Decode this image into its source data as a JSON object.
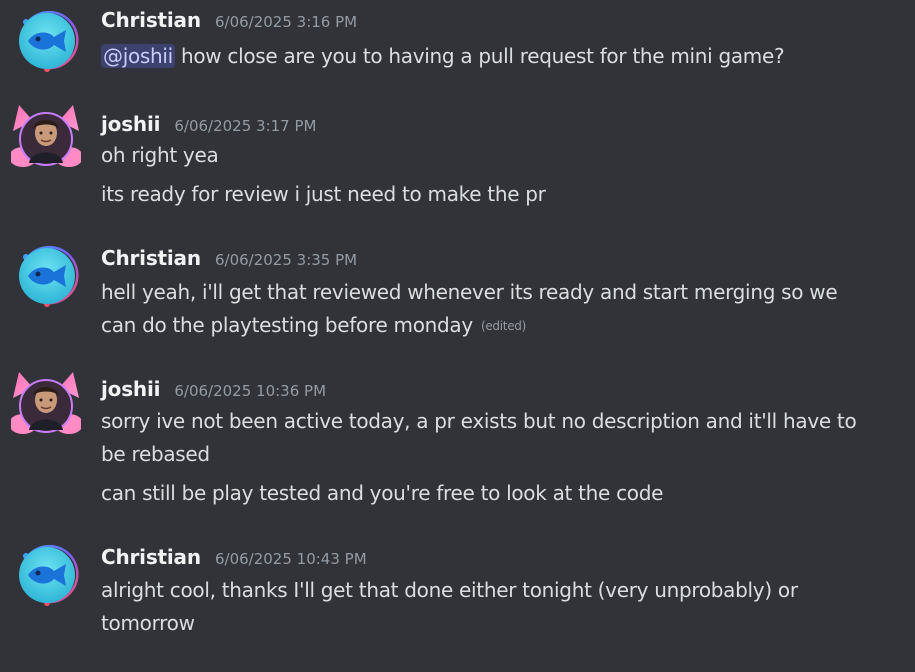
{
  "messages": [
    {
      "author": "Christian",
      "timestamp": "6/06/2025 3:16 PM",
      "avatar": "fish-avatar-icon",
      "lines": [
        {
          "mention": "@joshii",
          "text": " how close are you to having a pull request for the mini game?"
        }
      ]
    },
    {
      "author": "joshii",
      "timestamp": "6/06/2025 3:17 PM",
      "avatar": "photo-avatar",
      "lines": [
        {
          "text": "oh right yea"
        },
        {
          "text": "its ready for review i just need to make the pr"
        }
      ]
    },
    {
      "author": "Christian",
      "timestamp": "6/06/2025 3:35 PM",
      "avatar": "fish-avatar-icon",
      "lines": [
        {
          "text": "hell yeah, i'll get that reviewed whenever its ready and start merging so we"
        },
        {
          "text": "can do the playtesting before monday",
          "edited": "(edited)"
        }
      ]
    },
    {
      "author": "joshii",
      "timestamp": "6/06/2025 10:36 PM",
      "avatar": "photo-avatar",
      "lines": [
        {
          "text": "sorry ive not been active today, a pr exists but no description and it'll have to"
        },
        {
          "text": "be rebased"
        },
        {
          "text": "can still be play tested and you're free to look at the code"
        }
      ]
    },
    {
      "author": "Christian",
      "timestamp": "6/06/2025 10:43 PM",
      "avatar": "fish-avatar-icon",
      "lines": [
        {
          "text": "alright cool, thanks I'll get that done either tonight (very unprobably) or"
        },
        {
          "text": "tomorrow"
        }
      ]
    }
  ],
  "colors": {
    "background": "#313338",
    "author": "#f2f3f5",
    "timestamp": "#949ba4",
    "text": "#dbdee1",
    "mention_bg": "#3c4270",
    "mention_text": "#c9cdfb"
  }
}
